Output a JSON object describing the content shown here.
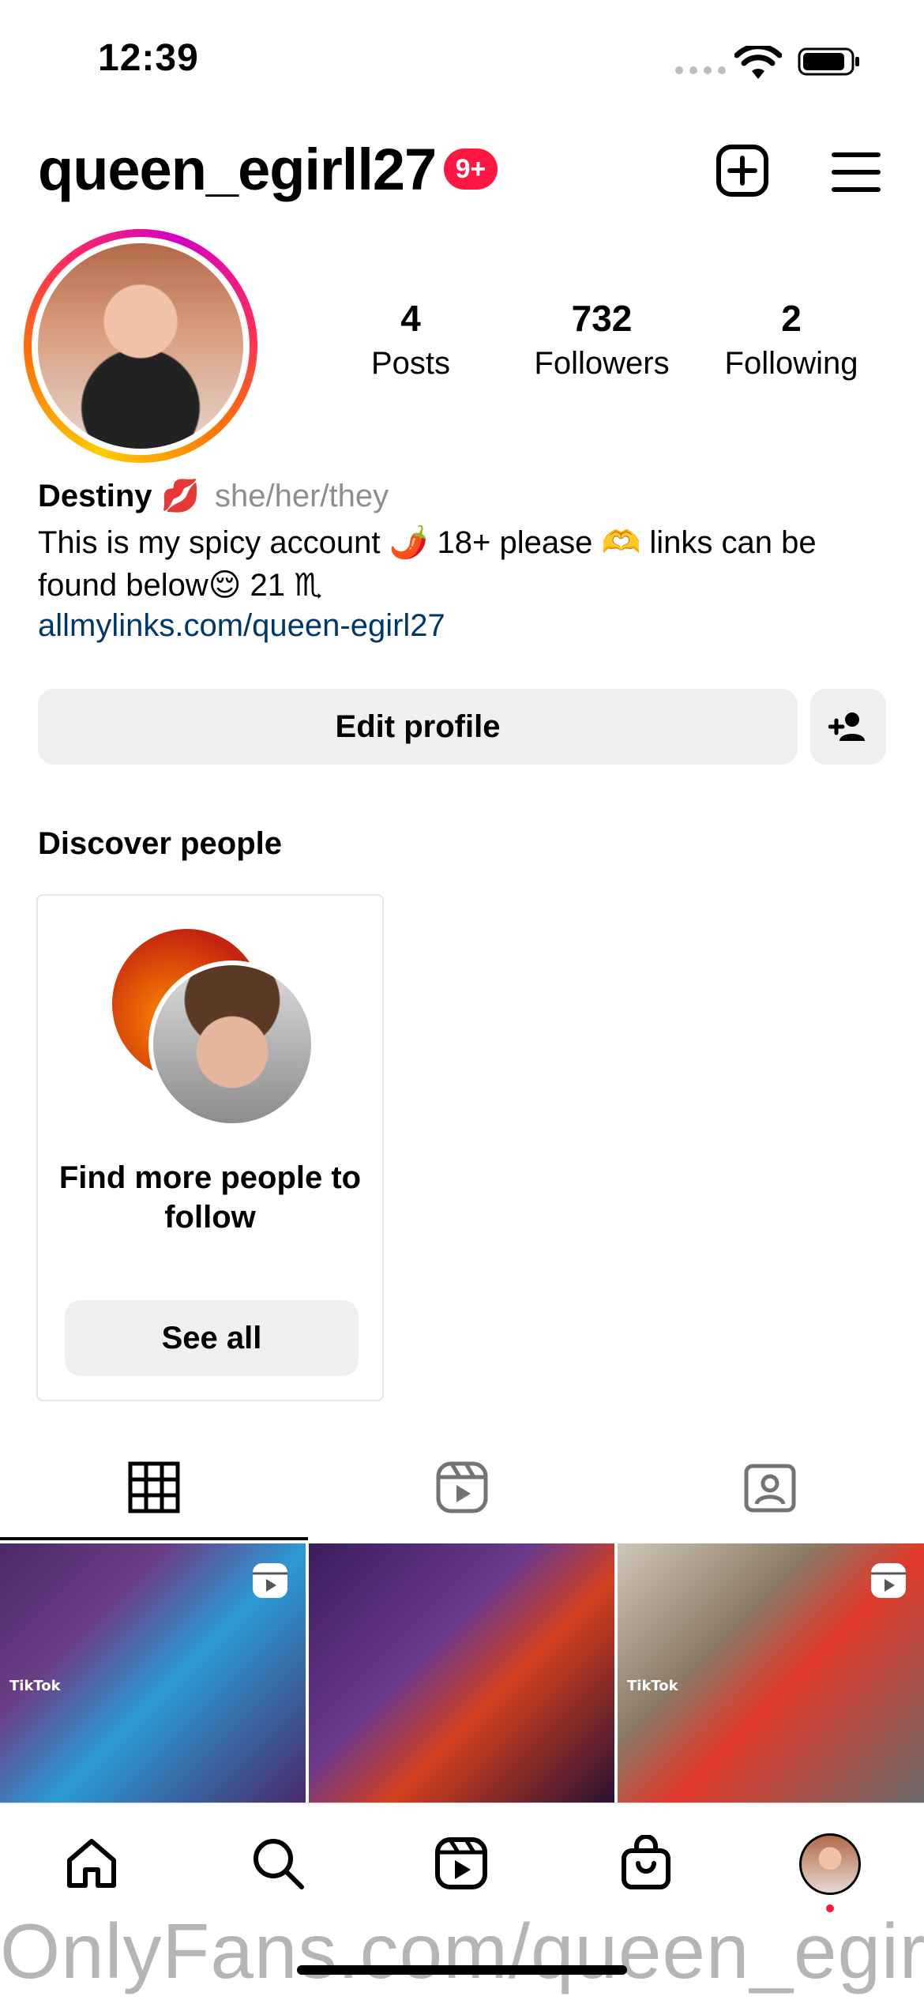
{
  "status_bar": {
    "time": "12:39"
  },
  "header": {
    "username": "queen_egirll27",
    "notification_badge": "9+"
  },
  "stats": [
    {
      "value": "4",
      "label": "Posts"
    },
    {
      "value": "732",
      "label": "Followers"
    },
    {
      "value": "2",
      "label": "Following"
    }
  ],
  "bio": {
    "name": "Destiny 💋",
    "pronouns": "she/her/they",
    "text": "This is my spicy account 🌶️ 18+ please 🫶 links can be found below😌 21 ♏",
    "link": "allmylinks.com/queen-egirl27"
  },
  "buttons": {
    "edit_profile": "Edit profile"
  },
  "discover": {
    "title": "Discover people",
    "card_text": "Find more people to follow",
    "see_all": "See all"
  },
  "grid": {
    "tiles": [
      {
        "watermark": "TikTok",
        "reel": true
      },
      {
        "watermark": "",
        "reel": false
      },
      {
        "watermark": "TikTok",
        "reel": true
      }
    ]
  },
  "watermark": "OnlyFans.com/queen_egir",
  "colors": {
    "badge": "#ff1744",
    "link": "#00376b",
    "button_bg": "#efefef"
  },
  "icons": [
    "add-post-icon",
    "menu-icon",
    "add-person-icon",
    "grid-icon",
    "reels-icon",
    "tagged-icon",
    "home-icon",
    "search-icon",
    "reels-nav-icon",
    "shop-icon"
  ]
}
